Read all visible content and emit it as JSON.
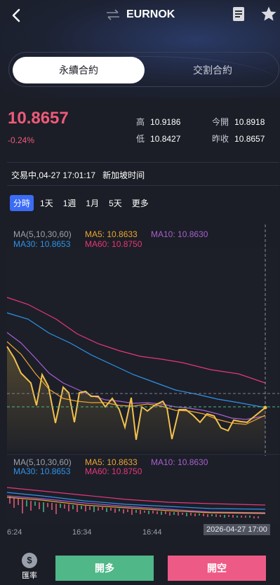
{
  "header": {
    "title": "EURNOK"
  },
  "segments": {
    "perpetual": "永續合約",
    "delivery": "交割合約"
  },
  "quote": {
    "price": "10.8657",
    "change": "-0.24%",
    "high_label": "高",
    "high": "10.9186",
    "low_label": "低",
    "low": "10.8427",
    "open_label": "今開",
    "open": "10.8918",
    "prev_label": "昨收",
    "prev": "10.8657"
  },
  "status": {
    "text": "交易中,04-27 17:01:17",
    "timezone": "新加坡时间"
  },
  "tabs": [
    "分時",
    "1天",
    "1週",
    "1月",
    "5天",
    "更多"
  ],
  "ma_main": {
    "params": "MA(5,10,30,60)",
    "ma5": "MA5: 10.8633",
    "ma10": "MA10: 10.8630",
    "ma30": "MA30: 10.8653",
    "ma60": "MA60: 10.8750"
  },
  "ma_sub": {
    "params": "MA(5,10,30,60)",
    "ma5": "MA5: 10.8633",
    "ma10": "MA10: 10.8630",
    "ma30": "MA30: 10.8653",
    "ma60": "MA60: 10.8750"
  },
  "xaxis": {
    "t1": "6:24",
    "t2": "16:34",
    "t3": "16:44",
    "crosshair": "2026-04-27 17:00"
  },
  "footer": {
    "rate": "匯率",
    "long": "開多",
    "short": "開空"
  },
  "colors": {
    "up": "#ef5a7a",
    "ma5": "#f0a531",
    "ma10": "#a95fd0",
    "ma30": "#2f93e8",
    "ma60": "#e8367a",
    "long": "#4fb788",
    "short": "#ee5a86",
    "accent": "#3b6cf6"
  },
  "icons": [
    "back-icon",
    "swap-icon",
    "document-icon",
    "star-icon",
    "dollar-icon"
  ]
}
